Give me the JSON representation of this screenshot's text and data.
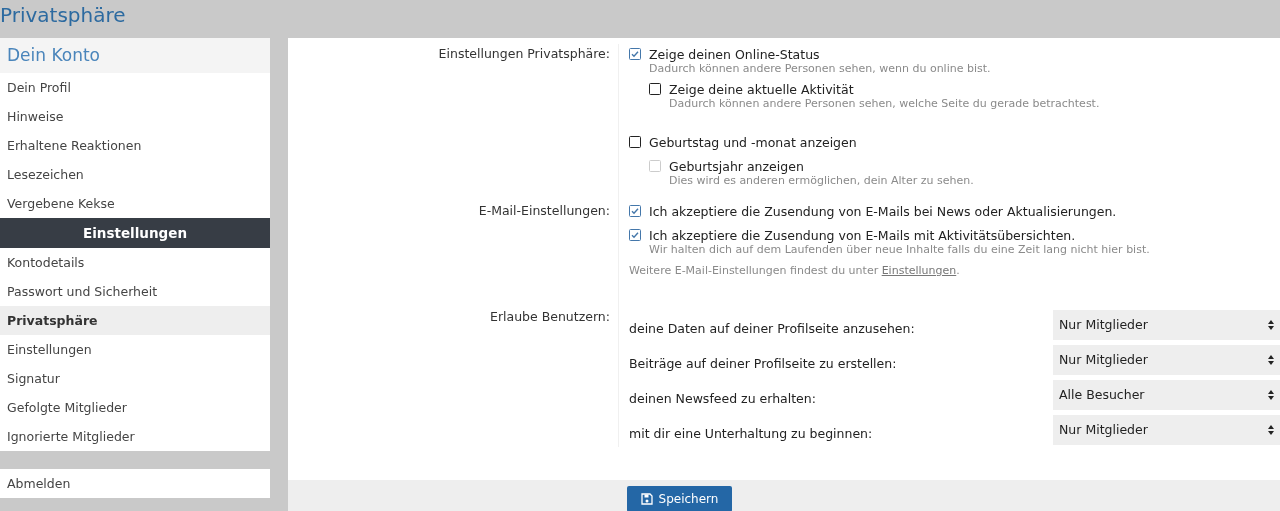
{
  "page_title": "Privatsphäre",
  "sidebar": {
    "header": "Dein Konto",
    "items": [
      {
        "label": "Dein Profil",
        "selected": false
      },
      {
        "label": "Hinweise",
        "selected": false
      },
      {
        "label": "Erhaltene Reaktionen",
        "selected": false
      },
      {
        "label": "Lesezeichen",
        "selected": false
      },
      {
        "label": "Vergebene Kekse",
        "selected": false
      }
    ],
    "section_header": "Einstellungen",
    "section_items": [
      {
        "label": "Kontodetails",
        "selected": false
      },
      {
        "label": "Passwort und Sicherheit",
        "selected": false
      },
      {
        "label": "Privatsphäre",
        "selected": true
      },
      {
        "label": "Einstellungen",
        "selected": false
      },
      {
        "label": "Signatur",
        "selected": false
      },
      {
        "label": "Gefolgte Mitglieder",
        "selected": false
      },
      {
        "label": "Ignorierte Mitglieder",
        "selected": false
      }
    ],
    "logout": "Abmelden"
  },
  "privacy": {
    "label": "Einstellungen Privatsphäre:",
    "groups": [
      [
        {
          "label": "Zeige deinen Online-Status",
          "checked": true,
          "disabled": false,
          "hint": "Dadurch können andere Personen sehen, wenn du online bist.",
          "children": [
            {
              "label": "Zeige deine aktuelle Aktivität",
              "checked": false,
              "disabled": false,
              "hint": "Dadurch können andere Personen sehen, welche Seite du gerade betrachtest."
            }
          ]
        }
      ],
      [
        {
          "label": "Geburtstag und -monat anzeigen",
          "checked": false,
          "disabled": false,
          "children": [
            {
              "label": "Geburtsjahr anzeigen",
              "checked": false,
              "disabled": true,
              "hint": "Dies wird es anderen ermöglichen, dein Alter zu sehen."
            }
          ]
        }
      ]
    ]
  },
  "email": {
    "label": "E-Mail-Einstellungen:",
    "options": [
      {
        "label": "Ich akzeptiere die Zusendung von E-Mails bei News oder Aktualisierungen.",
        "checked": true,
        "disabled": false
      },
      {
        "label": "Ich akzeptiere die Zusendung von E-Mails mit Aktivitätsübersichten.",
        "checked": true,
        "disabled": false,
        "hint": "Wir halten dich auf dem Laufenden über neue Inhalte falls du eine Zeit lang nicht hier bist."
      }
    ],
    "note": "Weitere E-Mail-Einstellungen findest du unter ",
    "note_link": "Einstellungen",
    "note_end": "."
  },
  "allow": {
    "label": "Erlaube Benutzern:",
    "rows": [
      {
        "label": "deine Daten auf deiner Profilseite anzusehen:",
        "value": "Nur Mitglieder"
      },
      {
        "label": "Beiträge auf deiner Profilseite zu erstellen:",
        "value": "Nur Mitglieder"
      },
      {
        "label": "deinen Newsfeed zu erhalten:",
        "value": "Alle Besucher"
      },
      {
        "label": "mit dir eine Unterhaltung zu beginnen:",
        "value": "Nur Mitglieder"
      }
    ]
  },
  "save_button": "Speichern"
}
